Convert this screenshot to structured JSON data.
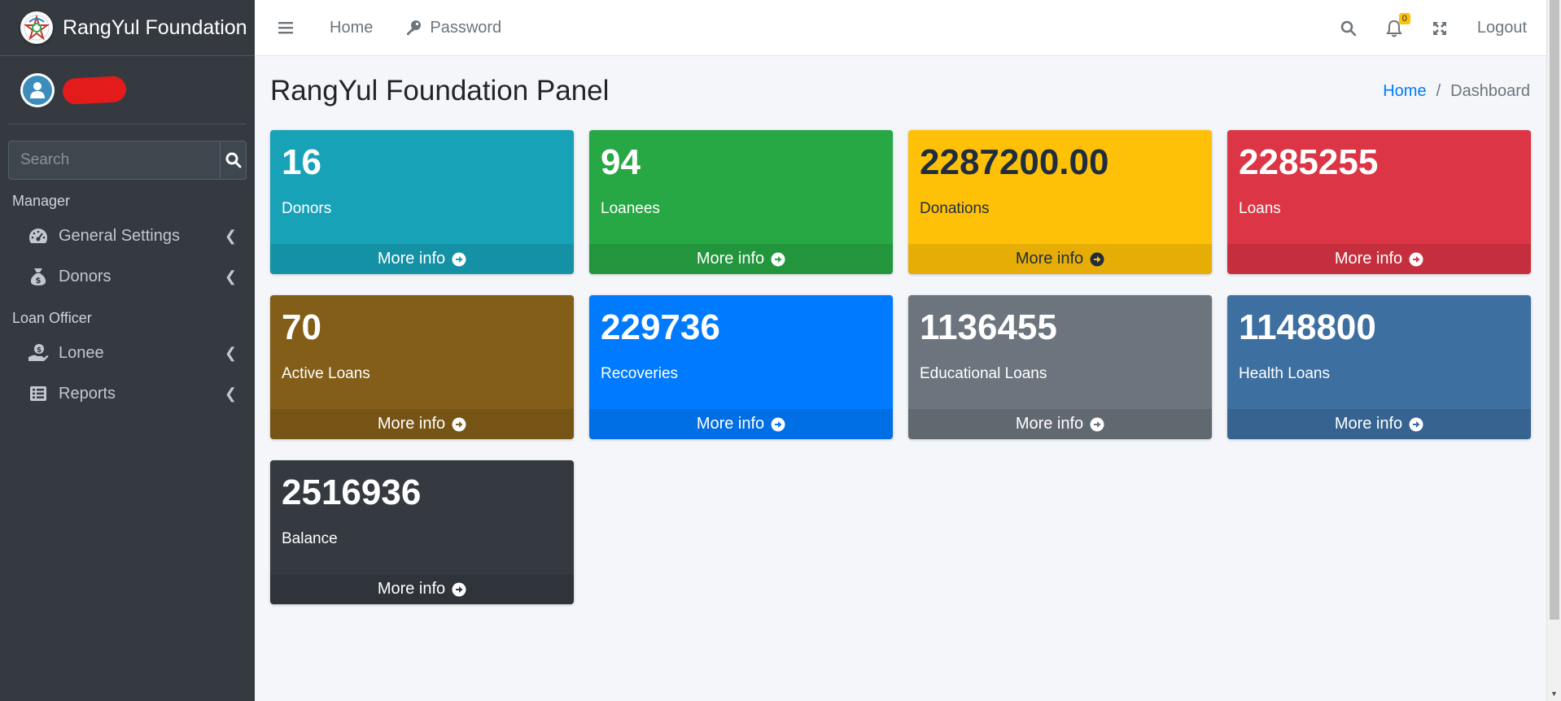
{
  "brand": {
    "name": "RangYul Foundation"
  },
  "sidebar": {
    "search_placeholder": "Search",
    "sections": [
      {
        "header": "Manager",
        "items": [
          {
            "label": "General Settings",
            "icon": "tachometer-icon"
          },
          {
            "label": "Donors",
            "icon": "money-bag-icon"
          }
        ]
      },
      {
        "header": "Loan Officer",
        "items": [
          {
            "label": "Lonee",
            "icon": "hand-holding-usd-icon"
          },
          {
            "label": "Reports",
            "icon": "list-icon"
          }
        ]
      }
    ]
  },
  "navbar": {
    "home": "Home",
    "password": "Password",
    "notifications_count": "0",
    "logout": "Logout"
  },
  "header": {
    "title": "RangYul Foundation Panel",
    "breadcrumb": {
      "home": "Home",
      "current": "Dashboard"
    }
  },
  "stats": [
    {
      "value": "16",
      "label": "Donors",
      "more": "More info",
      "color": "#17a2b8"
    },
    {
      "value": "94",
      "label": "Loanees",
      "more": "More info",
      "color": "#28a745"
    },
    {
      "value": "2287200.00",
      "label": "Donations",
      "more": "More info",
      "color": "#ffc107"
    },
    {
      "value": "2285255",
      "label": "Loans",
      "more": "More info",
      "color": "#dc3545"
    },
    {
      "value": "70",
      "label": "Active Loans",
      "more": "More info",
      "color": "#835e19"
    },
    {
      "value": "229736",
      "label": "Recoveries",
      "more": "More info",
      "color": "#007bff"
    },
    {
      "value": "1136455",
      "label": "Educational Loans",
      "more": "More info",
      "color": "#6c757d"
    },
    {
      "value": "1148800",
      "label": "Health Loans",
      "more": "More info",
      "color": "#3d6fa0"
    },
    {
      "value": "2516936",
      "label": "Balance",
      "more": "More info",
      "color": "#343a40"
    }
  ]
}
